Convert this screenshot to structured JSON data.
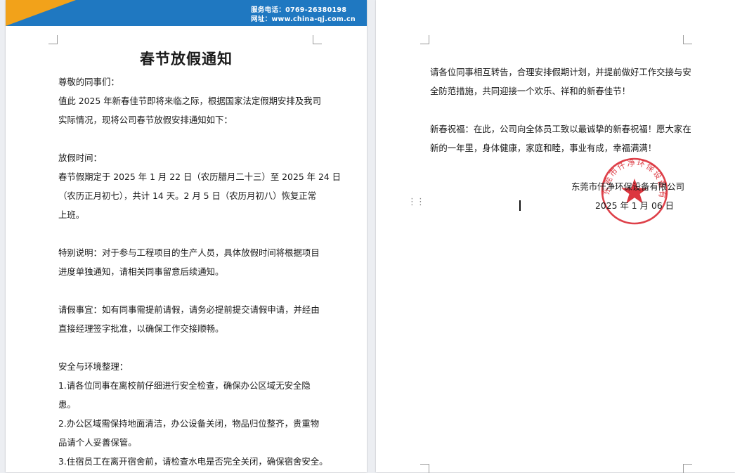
{
  "banner": {
    "phone_line": "服务电话：0769-26380198",
    "web_line": "网址：www.china-qj.com.cn"
  },
  "page1": {
    "title": "春节放假通知",
    "lines": [
      "尊敬的同事们：",
      "值此 2025 年新春佳节即将来临之际，根据国家法定假期安排及我司",
      "实际情况，现将公司春节放假安排通知如下：",
      "放假时间：",
      "春节假期定于 2025 年 1 月 22 日（农历腊月二十三）至 2025 年 24 日",
      "（农历正月初七），共计 14 天。2 月 5 日（农历月初八）恢复正常",
      "上班。",
      "特别说明：对于参与工程项目的生产人员，具体放假时间将根据项目",
      "进度单独通知，请相关同事留意后续通知。",
      "请假事宜：如有同事需提前请假，请务必提前提交请假申请，并经由",
      "直接经理签字批准，以确保工作交接顺畅。",
      "安全与环境整理：",
      "1.请各位同事在离校前仔细进行安全检查，确保办公区域无安全隐",
      "患。",
      "2.办公区域需保持地面清洁，办公设备关闭，物品归位整齐，贵重物",
      "品请个人妥善保管。",
      "3.住宿员工在离开宿舍前，请检查水电是否完全关闭，确保宿舍安全。"
    ]
  },
  "page2": {
    "lines": [
      "请各位同事相互转告，合理安排假期计划，并提前做好工作交接与安",
      "全防范措施，共同迎接一个欢乐、祥和的新春佳节！",
      "新春祝福：在此，公司向全体员工致以最诚挚的新春祝福！愿大家在",
      "新的一年里，身体健康，家庭和睦，事业有成，幸福满满！"
    ],
    "company": "东莞市仟净环保设备有限公司",
    "date": "2025 年 1 月 06 日",
    "stamp_text": "东莞市仟净环保设备有限公司"
  },
  "colors": {
    "banner_blue": "#1f78c1",
    "banner_orange": "#f2a21a",
    "stamp_red": "#d8202a"
  }
}
